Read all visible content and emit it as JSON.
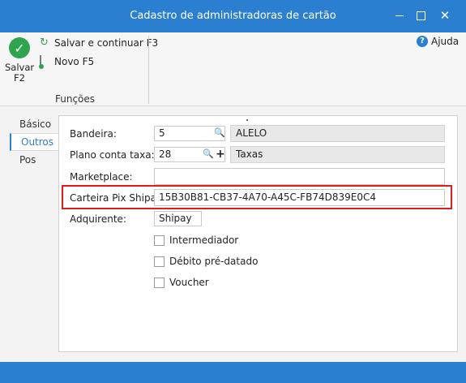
{
  "window": {
    "title": "Cadastro de administradoras de cartão",
    "minimize_icon": "minimize-icon",
    "maximize_icon": "maximize-icon",
    "close_glyph": "✕",
    "accent": "#2b7fd1"
  },
  "ribbon": {
    "save_label_line1": "Salvar",
    "save_label_line2": "F2",
    "save_continue_label": "Salvar e continuar F3",
    "new_label": "Novo F5",
    "group_label": "Funções",
    "help_label": "Ajuda"
  },
  "tabs": [
    {
      "label": "Básico",
      "selected": false
    },
    {
      "label": "Outros",
      "selected": true
    },
    {
      "label": "Pos",
      "selected": false
    }
  ],
  "form": {
    "bandeira": {
      "label": "Bandeira:",
      "value": "5",
      "description": "ALELO"
    },
    "plano_conta_taxa": {
      "label": "Plano conta taxa:",
      "value": "28",
      "description": "Taxas"
    },
    "marketplace": {
      "label": "Marketplace:",
      "value": ""
    },
    "carteira_pix": {
      "label": "Carteira Pix Shipay:",
      "value": "15B30B81-CB37-4A70-A45C-FB74D839E0C4"
    },
    "adquirente": {
      "label": "Adquirente:",
      "value": "Shipay"
    },
    "checkboxes": [
      {
        "label": "Intermediador",
        "checked": false
      },
      {
        "label": "Débito pré-datado",
        "checked": false
      },
      {
        "label": "Voucher",
        "checked": false
      }
    ]
  },
  "highlight_color": "#e01b1b"
}
